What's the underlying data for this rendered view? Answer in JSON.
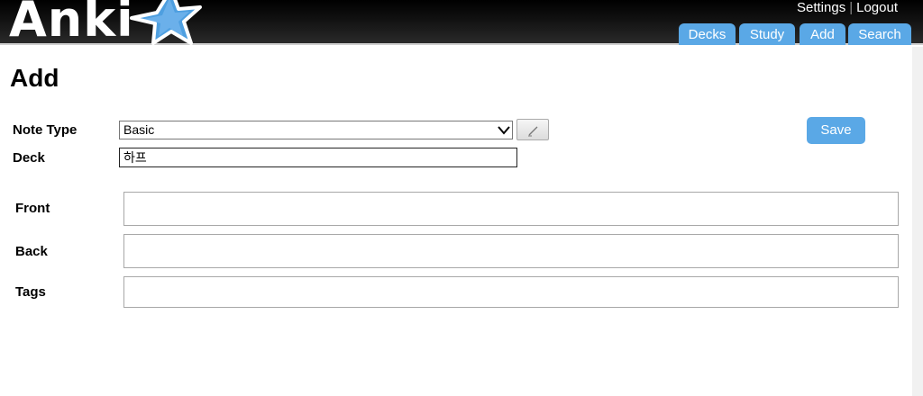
{
  "header": {
    "logo_text": "Anki",
    "top_links": [
      "Settings",
      "Logout"
    ],
    "tabs": [
      "Decks",
      "Study",
      "Add",
      "Search"
    ]
  },
  "page": {
    "title": "Add"
  },
  "form": {
    "note_type_label": "Note Type",
    "note_type_value": "Basic",
    "deck_label": "Deck",
    "deck_value": "하프",
    "save_label": "Save"
  },
  "fields": [
    {
      "label": "Front",
      "value": ""
    },
    {
      "label": "Back",
      "value": ""
    },
    {
      "label": "Tags",
      "value": ""
    }
  ],
  "colors": {
    "accent": "#5aa8e6",
    "header_bg": "#111111"
  }
}
